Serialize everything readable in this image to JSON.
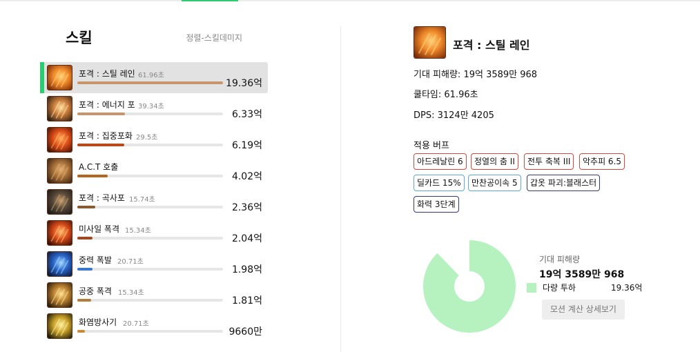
{
  "header": {
    "active_tab_color": "#2ecc71"
  },
  "skills_panel": {
    "title": "스킬",
    "subtitle": "정렬-스킬데미지",
    "items": [
      {
        "name": "포격 : 스틸 레인",
        "cooldown": "61.96초",
        "value": "19.36억",
        "ratio": 1.0,
        "bar_color": "#c9956c",
        "icon": "fire-rain-icon",
        "selected": true
      },
      {
        "name": "포격 : 에너지 포",
        "cooldown": "39.34초",
        "value": "6.33억",
        "ratio": 0.327,
        "bar_color": "#c9956c",
        "icon": "energy-cannon-icon"
      },
      {
        "name": "포격 : 집중포화",
        "cooldown": "29.5초",
        "value": "6.19억",
        "ratio": 0.32,
        "bar_color": "#b84a1a",
        "icon": "focus-fire-icon"
      },
      {
        "name": "A.C.T 호출",
        "cooldown": "",
        "value": "4.02억",
        "ratio": 0.208,
        "bar_color": "#b5651d",
        "icon": "act-call-icon"
      },
      {
        "name": "포격 : 곡사포",
        "cooldown": "15.74초",
        "value": "2.36억",
        "ratio": 0.122,
        "bar_color": "#8a5a35",
        "icon": "howitzer-icon"
      },
      {
        "name": "미사일 폭격",
        "cooldown": "15.34초",
        "value": "2.04억",
        "ratio": 0.105,
        "bar_color": "#a8441a",
        "icon": "missile-strike-icon"
      },
      {
        "name": "중력 폭발",
        "cooldown": "20.71초",
        "value": "1.98억",
        "ratio": 0.102,
        "bar_color": "#3a78d0",
        "icon": "gravity-blast-icon"
      },
      {
        "name": "공중 폭격",
        "cooldown": "15.34초",
        "value": "1.81억",
        "ratio": 0.094,
        "bar_color": "#b57d3a",
        "icon": "air-strike-icon"
      },
      {
        "name": "화염방사기",
        "cooldown": "20.71초",
        "value": "9660만",
        "ratio": 0.05,
        "bar_color": "#c98a3a",
        "icon": "flamethrower-icon"
      }
    ]
  },
  "detail": {
    "title": "포격 : 스틸 레인",
    "icon": "fire-rain-icon",
    "expected_damage": "기대 피해량: 19억 3589만 968",
    "cooldown": "쿨타임: 61.96초",
    "dps": "DPS: 3124만 4205",
    "buff_title": "적용 버프",
    "buffs": [
      {
        "label": "아드레날린 6",
        "color": "red"
      },
      {
        "label": "정열의 춤 II",
        "color": "red"
      },
      {
        "label": "전투 축복 III",
        "color": "red"
      },
      {
        "label": "악추피 6.5",
        "color": "red"
      },
      {
        "label": "딜카드 15%",
        "color": "blue"
      },
      {
        "label": "만찬공이속 5",
        "color": "blue"
      },
      {
        "label": "갑옷 파괴:블래스터",
        "color": "navy"
      },
      {
        "label": "화력 3단계",
        "color": "navy"
      }
    ]
  },
  "chart_data": {
    "type": "pie",
    "categories": [
      "다량 투하"
    ],
    "values": [
      1.0
    ],
    "color": "#b5f2c0",
    "caption": "기대 피해량",
    "total": "19억 3589만 968",
    "legend": [
      {
        "name": "다량 투하",
        "value": "19.36억"
      }
    ]
  },
  "motion_button": "모션 계산 상세보기"
}
